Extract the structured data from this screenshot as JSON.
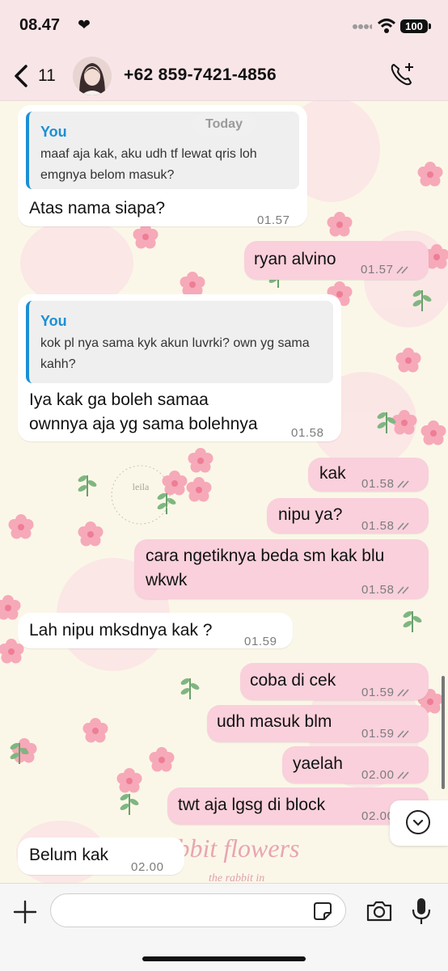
{
  "status_bar": {
    "time": "08.47",
    "battery": "100"
  },
  "header": {
    "back_count": "11",
    "contact": "+62 859-7421-4856"
  },
  "date_chip": "Today",
  "wallpaper": {
    "text_brand": "rabbit flowers",
    "text_sub": "the rabbit in",
    "stamp_text": "leila"
  },
  "messages": [
    {
      "dir": "in",
      "quote_name": "You",
      "quote_text": "maaf aja kak, aku udh tf lewat qris loh emgnya belom masuk?",
      "text": "Atas nama siapa?",
      "time": "01.57"
    },
    {
      "dir": "out",
      "text": "ryan alvino",
      "time": "01.57"
    },
    {
      "dir": "in",
      "quote_name": "You",
      "quote_text": "kok pl nya sama kyk akun luvrki? own yg sama kahh?",
      "text": "Iya kak ga boleh samaa ownnya aja yg sama bolehnya",
      "time": "01.58"
    },
    {
      "dir": "out",
      "text": "kak",
      "time": "01.58"
    },
    {
      "dir": "out",
      "text": "nipu ya?",
      "time": "01.58"
    },
    {
      "dir": "out",
      "text": "cara ngetiknya beda sm kak blu wkwk",
      "time": "01.58"
    },
    {
      "dir": "in",
      "text": "Lah nipu mksdnya kak ?",
      "time": "01.59"
    },
    {
      "dir": "out",
      "text": "coba di cek",
      "time": "01.59"
    },
    {
      "dir": "out",
      "text": "udh masuk blm",
      "time": "01.59"
    },
    {
      "dir": "out",
      "text": "yaelah",
      "time": "02.00"
    },
    {
      "dir": "out",
      "text": "twt aja lgsg di block",
      "time": "02.00"
    },
    {
      "dir": "in",
      "text": "Belum kak",
      "time": "02.00"
    }
  ],
  "composer": {
    "value": ""
  },
  "colors": {
    "incoming": "#ffffff",
    "outgoing": "#f9d0dc",
    "quote_accent": "#1b8fd6",
    "wallpaper": "#fbf7e8"
  },
  "icons": [
    "back-chevron-icon",
    "avatar",
    "add-call-icon",
    "plus-icon",
    "sticker-icon",
    "camera-icon",
    "mic-icon",
    "chevron-down-icon",
    "read-ticks-icon"
  ]
}
